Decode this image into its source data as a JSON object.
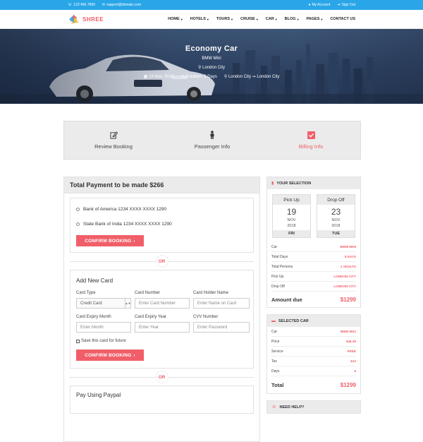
{
  "topbar": {
    "phone": "123 456 7890",
    "email": "support@domain.com",
    "account": "My Account",
    "signout": "Sign Out"
  },
  "brand": {
    "name": "SHREE",
    "accent": "#f05f69",
    "topbar_color": "#29a6e8"
  },
  "menu": [
    "HOME",
    "HOTELS",
    "TOURS",
    "CRUISE",
    "CAR",
    "BLOG",
    "PAGES",
    "CONTACT US"
  ],
  "hero": {
    "title": "Economy Car",
    "subtitle": "BMW Mini",
    "location": "London City",
    "date": "19 Nov, 2018",
    "duration": "Duration: 5 Days",
    "route": "London City ➞ London City"
  },
  "steps": [
    {
      "label": "Review Booking",
      "icon": "edit-icon"
    },
    {
      "label": "Passenger Info",
      "icon": "person-icon"
    },
    {
      "label": "Billing Info",
      "icon": "checkbox-icon"
    }
  ],
  "payment": {
    "title": "Total Payment to be made $266",
    "banks": [
      "Bank of America 1234 XXXX XXXX 1290",
      "State Bank of India 1234 XXXX XXXX 1290"
    ],
    "confirm": "CONFIRM BOOKING",
    "or": "OR",
    "new_card": {
      "title": "Add New Card",
      "labels": {
        "type": "Card Type",
        "number": "Card Number",
        "holder": "Card Holder Name",
        "exp_month": "Card Expiry Month",
        "exp_year": "Card Expiry Year",
        "cvv": "CVV Number"
      },
      "type_value": "Credit Card",
      "placeholders": {
        "number": "Enter Card Number",
        "holder": "Enter Name on Card",
        "exp_month": "Enter Month",
        "exp_year": "Enter Year",
        "cvv": "Enter Password"
      },
      "save": "Save this card for future"
    },
    "paypal": "Pay Using Paypal"
  },
  "selection": {
    "title": "YOUR SELECTION",
    "pickup": {
      "label": "Pick Up",
      "day": "19",
      "month": "NOV",
      "year": "2018",
      "weekday": "FRI"
    },
    "dropoff": {
      "label": "Drop Off",
      "day": "23",
      "month": "NOV",
      "year": "2018",
      "weekday": "TUE"
    },
    "rows": [
      {
        "k": "Car",
        "v": "BMW MINI"
      },
      {
        "k": "Total Days",
        "v": "5 DAYS"
      },
      {
        "k": "Total Persons",
        "v": "2 ADULTS"
      },
      {
        "k": "Pick Up",
        "v": "LONDON CITY"
      },
      {
        "k": "Drop Off",
        "v": "LONDON CITY"
      }
    ],
    "amount_label": "Amount due",
    "amount": "$1299"
  },
  "selected_car": {
    "title": "SELECTED CAR",
    "rows": [
      {
        "k": "Car",
        "v": "BMW Mini"
      },
      {
        "k": "Price",
        "v": "$45.39"
      },
      {
        "k": "Service",
        "v": "FREE"
      },
      {
        "k": "Tax",
        "v": "$12"
      },
      {
        "k": "Days",
        "v": "5"
      }
    ],
    "total_label": "Total",
    "total": "$1299"
  },
  "help": {
    "title": "NEED HELP?"
  }
}
